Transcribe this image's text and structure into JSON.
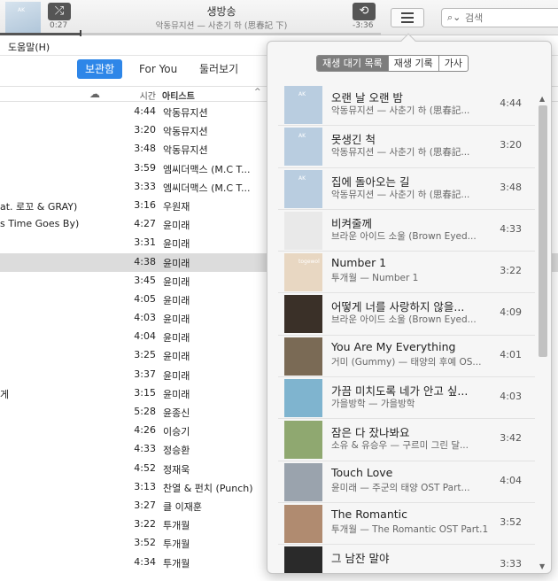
{
  "now_playing": {
    "title": "생방송",
    "subtitle": "악동뮤지션 — 사춘기 하 (思春記 下)",
    "elapsed": "0:27",
    "remaining": "-3:36",
    "progress_fraction": 0.21,
    "art_text": "AK"
  },
  "icons": {
    "shuffle": "shuffle-icon",
    "repeat": "repeat-icon",
    "list": "list-icon",
    "search": "search-icon",
    "cloud": "cloud-icon"
  },
  "search": {
    "placeholder": "검색"
  },
  "menu": {
    "help": "도움말(H)"
  },
  "nav": {
    "tabs": [
      "보관함",
      "For You",
      "둘러보기"
    ],
    "active": 0
  },
  "table": {
    "headers": {
      "time": "시간",
      "artist": "아티스트",
      "sort": "^"
    },
    "rows": [
      {
        "title": "",
        "time": "4:44",
        "artist": "악동뮤지션"
      },
      {
        "title": "",
        "time": "3:20",
        "artist": "악동뮤지션"
      },
      {
        "title": "",
        "time": "3:48",
        "artist": "악동뮤지션"
      },
      {
        "title": "",
        "time": "3:59",
        "artist": "엠씨더맥스 (M.C T..."
      },
      {
        "title": "",
        "time": "3:33",
        "artist": "엠씨더맥스 (M.C T..."
      },
      {
        "title": "at. 로꼬 & GRAY)",
        "time": "3:16",
        "artist": "우원재"
      },
      {
        "title": "s Time Goes By)",
        "time": "4:27",
        "artist": "윤미래"
      },
      {
        "title": "",
        "time": "3:31",
        "artist": "윤미래"
      },
      {
        "title": "",
        "time": "4:38",
        "artist": "윤미래",
        "selected": true
      },
      {
        "title": "",
        "time": "3:45",
        "artist": "윤미래"
      },
      {
        "title": "",
        "time": "4:05",
        "artist": "윤미래"
      },
      {
        "title": "",
        "time": "4:03",
        "artist": "윤미래"
      },
      {
        "title": "",
        "time": "4:04",
        "artist": "윤미래"
      },
      {
        "title": "",
        "time": "3:25",
        "artist": "윤미래"
      },
      {
        "title": "",
        "time": "3:37",
        "artist": "윤미래"
      },
      {
        "title": "게",
        "time": "3:15",
        "artist": "윤미래"
      },
      {
        "title": "",
        "time": "5:28",
        "artist": "윤종신"
      },
      {
        "title": "",
        "time": "4:26",
        "artist": "이승기"
      },
      {
        "title": "",
        "time": "4:33",
        "artist": "정승환"
      },
      {
        "title": "",
        "time": "4:52",
        "artist": "정재욱"
      },
      {
        "title": "",
        "time": "3:13",
        "artist": "찬열 & 펀치 (Punch)"
      },
      {
        "title": "",
        "time": "3:27",
        "artist": "클 이재훈"
      },
      {
        "title": "",
        "time": "3:22",
        "artist": "투개월"
      },
      {
        "title": "",
        "time": "3:52",
        "artist": "투개월"
      },
      {
        "title": "",
        "time": "4:34",
        "artist": "투개월"
      }
    ]
  },
  "popover": {
    "segments": [
      "재생 대기 목록",
      "재생 기록",
      "가사"
    ],
    "active_segment": 0,
    "scroll_up": "▲",
    "scroll_down": "▼",
    "queue": [
      {
        "title": "오랜 날 오랜 밤",
        "subtitle": "악동뮤지션 — 사춘기 하 (思春記...",
        "time": "4:44",
        "art": "#b9cde0",
        "art_text": "AK"
      },
      {
        "title": "못생긴 척",
        "subtitle": "악동뮤지션 — 사춘기 하 (思春記...",
        "time": "3:20",
        "art": "#b9cde0",
        "art_text": "AK"
      },
      {
        "title": "집에 돌아오는 길",
        "subtitle": "악동뮤지션 — 사춘기 하 (思春記...",
        "time": "3:48",
        "art": "#b9cde0",
        "art_text": "AK"
      },
      {
        "title": "비켜줄께",
        "subtitle": "브라운 아이드 소울 (Brown Eyed...",
        "time": "4:33",
        "art": "#e9e9e9",
        "art_text": ""
      },
      {
        "title": "Number 1",
        "subtitle": "투개월 — Number 1",
        "time": "3:22",
        "art": "#e8d7c2",
        "art_text": "togewol"
      },
      {
        "title": "어떻게 너를 사랑하지 않을...",
        "subtitle": "브라운 아이드 소울 (Brown Eyed...",
        "time": "4:09",
        "art": "#3a3028",
        "art_text": ""
      },
      {
        "title": "You Are My Everything",
        "subtitle": "거미 (Gummy) — 태양의 후예 OS...",
        "time": "4:01",
        "art": "#7a6a55",
        "art_text": ""
      },
      {
        "title": "가끔 미치도록 네가 안고 싶...",
        "subtitle": "가을방학 — 가을방학",
        "time": "4:03",
        "art": "#7fb4cf",
        "art_text": ""
      },
      {
        "title": "잠은 다 잤나봐요",
        "subtitle": "소유 & 유승우 — 구르미 그린 달...",
        "time": "3:42",
        "art": "#8fa870",
        "art_text": ""
      },
      {
        "title": "Touch Love",
        "subtitle": "윤미래 — 주군의 태양 OST Part...",
        "time": "4:04",
        "art": "#9aa3ad",
        "art_text": ""
      },
      {
        "title": "The Romantic",
        "subtitle": "투개월 — The Romantic OST Part.1",
        "time": "3:52",
        "art": "#b08b70",
        "art_text": ""
      },
      {
        "title": "그 남잔 말야",
        "subtitle": "",
        "time": "3:33",
        "art": "#2a2a2a",
        "art_text": ""
      }
    ]
  }
}
